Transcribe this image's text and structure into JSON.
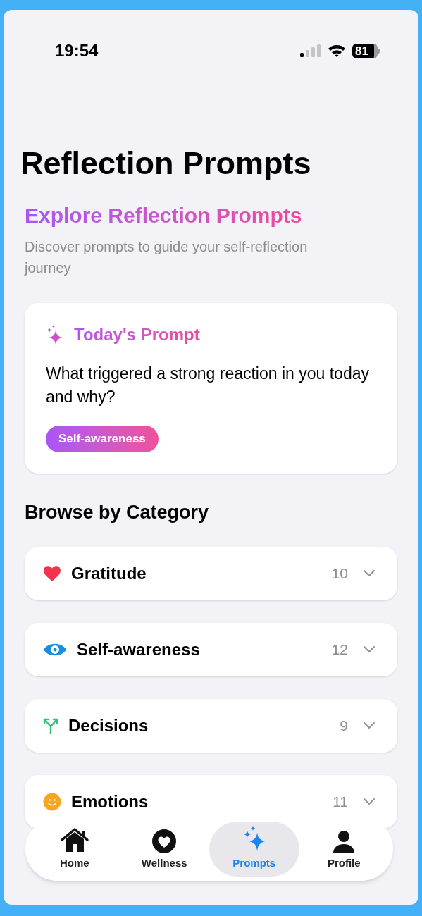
{
  "status_bar": {
    "time": "19:54",
    "battery": "81"
  },
  "title": "Reflection Prompts",
  "heading": "Explore Reflection Prompts",
  "subtitle": "Discover prompts to guide your self-reflection journey",
  "todays_prompt": {
    "label": "Today's Prompt",
    "text": "What triggered a strong reaction in you today and why?",
    "tag": "Self-awareness"
  },
  "section_title": "Browse by Category",
  "categories": [
    {
      "kind": "heart",
      "name": "Gratitude",
      "count": "10",
      "expanded": false
    },
    {
      "kind": "eye",
      "name": "Self-awareness",
      "count": "12",
      "expanded": false
    },
    {
      "kind": "split",
      "name": "Decisions",
      "count": "9",
      "expanded": false
    },
    {
      "kind": "smile",
      "name": "Emotions",
      "count": "11",
      "expanded": false
    }
  ],
  "tabs": [
    {
      "kind": "home",
      "label": "Home",
      "selected": false
    },
    {
      "kind": "wellness",
      "label": "Wellness",
      "selected": false
    },
    {
      "kind": "prompts",
      "label": "Prompts",
      "selected": true
    },
    {
      "kind": "profile",
      "label": "Profile",
      "selected": false
    }
  ]
}
